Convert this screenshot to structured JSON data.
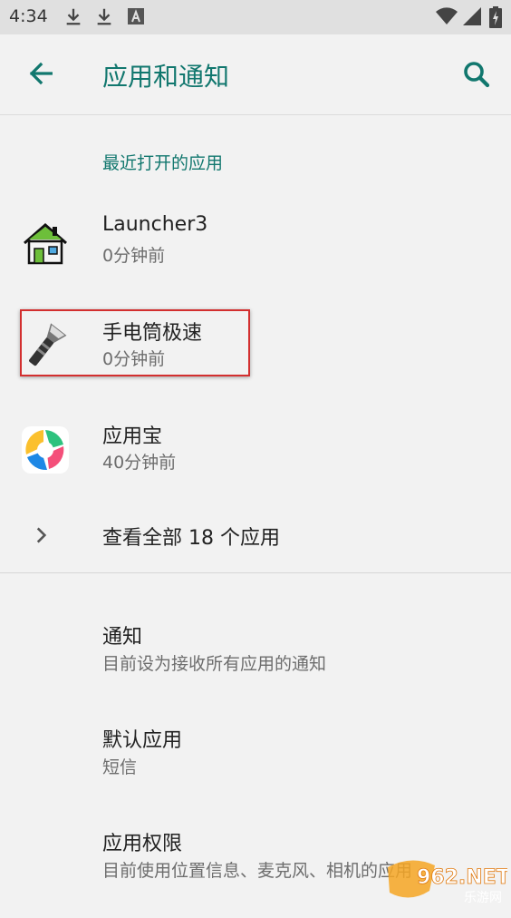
{
  "status_bar": {
    "time": "4:34",
    "icons": [
      "download-icon",
      "download-icon",
      "font-a-icon",
      "wifi-icon",
      "signal-icon",
      "battery-icon"
    ]
  },
  "app_bar": {
    "title": "应用和通知",
    "back_icon": "arrow-back-icon",
    "search_icon": "search-icon",
    "accent_color": "#11776e"
  },
  "recent": {
    "header": "最近打开的应用",
    "apps": [
      {
        "name": "Launcher3",
        "time": "0分钟前",
        "icon": "house-icon"
      },
      {
        "name": "手电筒极速",
        "time": "0分钟前",
        "icon": "flashlight-icon"
      },
      {
        "name": "应用宝",
        "time": "40分钟前",
        "icon": "yingyongbao-icon"
      }
    ],
    "see_all": "查看全部 18 个应用"
  },
  "prefs": [
    {
      "title": "通知",
      "summary": "目前设为接收所有应用的通知"
    },
    {
      "title": "默认应用",
      "summary": "短信"
    },
    {
      "title": "应用权限",
      "summary": "目前使用位置信息、麦克风、相机的应用"
    }
  ],
  "highlight_color": "#d32f2f",
  "watermark": {
    "main": "962.NET",
    "sub": "乐游网"
  }
}
